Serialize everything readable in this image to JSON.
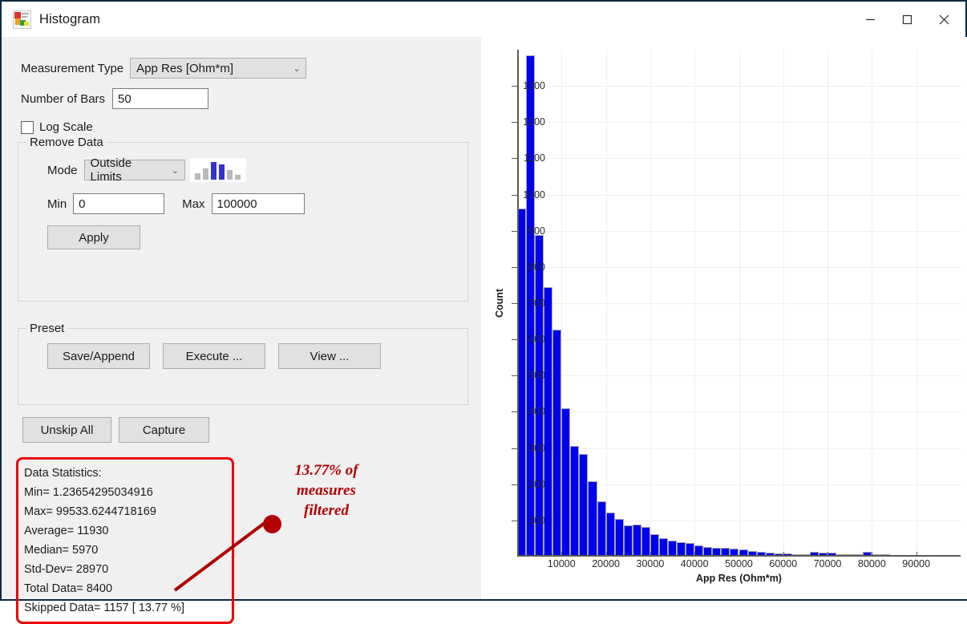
{
  "window": {
    "title": "Histogram",
    "icon": "histogram-app-icon",
    "minimize_label": "minimize-icon",
    "maximize_label": "maximize-icon",
    "close_label": "close-icon"
  },
  "panel": {
    "measurement_type_label": "Measurement Type",
    "measurement_type_value": "App Res [Ohm*m]",
    "number_of_bars_label": "Number of Bars",
    "number_of_bars_value": "50",
    "log_scale_label": "Log Scale",
    "log_scale_checked": false,
    "remove_data": {
      "title": "Remove Data",
      "mode_label": "Mode",
      "mode_value": "Outside Limits",
      "min_label": "Min",
      "min_value": "0",
      "max_label": "Max",
      "max_value": "100000",
      "apply_label": "Apply"
    },
    "preset": {
      "title": "Preset",
      "save_append_label": "Save/Append",
      "execute_label": "Execute ...",
      "view_label": "View ..."
    },
    "unskip_all_label": "Unskip All",
    "capture_label": "Capture"
  },
  "statistics": {
    "heading": "Data Statistics:",
    "lines": [
      "Data Statistics:",
      "Min= 1.23654295034916",
      "Max= 99533.6244718169",
      "Average= 11930",
      "Median= 5970",
      "Std-Dev= 28970",
      "Total Data= 8400",
      "Skipped Data= 1157 [ 13.77 %]"
    ],
    "min": "1.23654295034916",
    "max": "99533.6244718169",
    "average": "11930",
    "median": "5970",
    "std_dev": "28970",
    "total_data": "8400",
    "skipped_data": "1157",
    "skipped_percent": "13.77 %",
    "border_color": "#ee0000"
  },
  "annotation": {
    "text": "13.77% of measures filtered",
    "line1": "13.77% of",
    "line2": "measures",
    "line3": "filtered",
    "color": "#b30000"
  },
  "chart_data": {
    "type": "bar",
    "title": "",
    "xlabel": "App Res (Ohm*m)",
    "ylabel": "Count",
    "bar_color": "#0000ee",
    "grid": true,
    "legend": false,
    "xlim": [
      0,
      100000
    ],
    "ylim": [
      0,
      1400
    ],
    "ytick_labels": [
      "100",
      "200",
      "300",
      "400",
      "500",
      "600",
      "700",
      "800",
      "900",
      "1000",
      "1100",
      "1200",
      "1300"
    ],
    "ytick_values": [
      100,
      200,
      300,
      400,
      500,
      600,
      700,
      800,
      900,
      1000,
      1100,
      1200,
      1300
    ],
    "xtick_labels": [
      "10000",
      "20000",
      "30000",
      "40000",
      "50000",
      "60000",
      "70000",
      "80000",
      "90000"
    ],
    "xtick_values": [
      10000,
      20000,
      30000,
      40000,
      50000,
      60000,
      70000,
      80000,
      90000
    ],
    "bin_width": 2000,
    "x": [
      1000,
      3000,
      5000,
      7000,
      9000,
      11000,
      13000,
      15000,
      17000,
      19000,
      21000,
      23000,
      25000,
      27000,
      29000,
      31000,
      33000,
      35000,
      37000,
      39000,
      41000,
      43000,
      45000,
      47000,
      49000,
      51000,
      53000,
      55000,
      57000,
      59000,
      61000,
      63000,
      65000,
      67000,
      69000,
      71000,
      73000,
      75000,
      77000,
      79000,
      81000,
      83000,
      85000,
      87000,
      89000,
      91000,
      93000,
      95000,
      97000,
      99000
    ],
    "values": [
      962,
      1385,
      888,
      744,
      627,
      410,
      306,
      283,
      208,
      153,
      121,
      105,
      86,
      89,
      82,
      61,
      50,
      44,
      39,
      37,
      31,
      27,
      25,
      25,
      23,
      19,
      15,
      13,
      12,
      10,
      9,
      6,
      6,
      14,
      11,
      12,
      7,
      7,
      7,
      13,
      6,
      6,
      5,
      4,
      4,
      3,
      3,
      2,
      2,
      2
    ]
  }
}
